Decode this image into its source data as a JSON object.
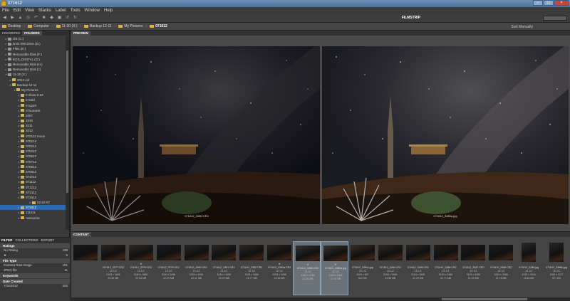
{
  "window": {
    "title": "071612"
  },
  "menu": [
    "File",
    "Edit",
    "View",
    "Stacks",
    "Label",
    "Tools",
    "Window",
    "Help"
  ],
  "toolbar": {
    "workspace": "FILMSTRIP",
    "sort": "Sort Manually"
  },
  "breadcrumb": [
    "Desktop",
    "Computer",
    "11-30 (X:)",
    "Backup 12-11",
    "My Pictures",
    "071612"
  ],
  "left_tabs": [
    "FAVORITES",
    "FOLDERS"
  ],
  "tree": [
    {
      "label": "OS (C:)",
      "icon": "drive"
    },
    {
      "label": "DVD RW Drive (D:)",
      "icon": "drive"
    },
    {
      "label": "Files (E:)",
      "icon": "drive"
    },
    {
      "label": "Removable Disk (F:)",
      "icon": "drive"
    },
    {
      "label": "EOS_DIGITAL (G:)",
      "icon": "drive"
    },
    {
      "label": "Removable Disk (H:)",
      "icon": "drive"
    },
    {
      "label": "Removable Disk (I:)",
      "icon": "drive"
    },
    {
      "label": "11-30 (X:)",
      "icon": "drive"
    },
    {
      "label": "2012 cal",
      "icon": "folder"
    },
    {
      "label": "Backup 12-11",
      "icon": "folder"
    },
    {
      "label": "My Pictures",
      "icon": "folder"
    },
    {
      "label": "0 show 6-10",
      "icon": "folder"
    },
    {
      "label": "0 Sold",
      "icon": "folder"
    },
    {
      "label": "0 top20",
      "icon": "folder"
    },
    {
      "label": "07sunsets",
      "icon": "folder"
    },
    {
      "label": "2007",
      "icon": "folder"
    },
    {
      "label": "2010",
      "icon": "folder"
    },
    {
      "label": "2011",
      "icon": "folder"
    },
    {
      "label": "2012",
      "icon": "folder"
    },
    {
      "label": "070112 moon",
      "icon": "folder"
    },
    {
      "label": "070212",
      "icon": "folder"
    },
    {
      "label": "070312",
      "icon": "folder"
    },
    {
      "label": "070412",
      "icon": "folder"
    },
    {
      "label": "070612",
      "icon": "folder"
    },
    {
      "label": "070712",
      "icon": "folder"
    },
    {
      "label": "070812",
      "icon": "folder"
    },
    {
      "label": "070912",
      "icon": "folder"
    },
    {
      "label": "071012",
      "icon": "folder"
    },
    {
      "label": "071112",
      "icon": "folder"
    },
    {
      "label": "071212",
      "icon": "folder"
    },
    {
      "label": "071412",
      "icon": "folder"
    },
    {
      "label": "071512",
      "icon": "folder"
    },
    {
      "label": "02-22-07",
      "icon": "folder"
    },
    {
      "label": "071612",
      "icon": "folder",
      "selected": true
    },
    {
      "label": "111311",
      "icon": "folder"
    },
    {
      "label": "Awesome",
      "icon": "folder"
    }
  ],
  "filter": {
    "tabs": [
      "FILTER",
      "COLLECTIONS",
      "EXPORT"
    ],
    "sections": [
      {
        "title": "Ratings",
        "rows": [
          {
            "label": "No Rating",
            "count": "196"
          },
          {
            "label": "★",
            "count": "5"
          }
        ]
      },
      {
        "title": "File Type",
        "rows": [
          {
            "label": "Camera Raw image",
            "count": "191"
          },
          {
            "label": "JPEG file",
            "count": "11"
          }
        ]
      },
      {
        "title": "Keywords",
        "rows": []
      },
      {
        "title": "Date Created",
        "rows": [
          {
            "label": "7/16/2012",
            "count": "200"
          }
        ]
      }
    ]
  },
  "preview": {
    "tab": "PREVIEW",
    "images": [
      {
        "caption": "071612_3380.CR2"
      },
      {
        "caption": "071612_3380a.jpg"
      }
    ]
  },
  "content": {
    "tab": "CONTENT",
    "thumbs": [
      {
        "name": "",
        "star": "",
        "meta1": "",
        "meta2": "",
        "meta3": "",
        "selected": false
      },
      {
        "name": "071612_3377.CR2",
        "star": "",
        "meta1": "15 1/2",
        "meta2": "5184 x 3456",
        "meta3": "22.39 MB",
        "selected": false
      },
      {
        "name": "071612_3378.CR2",
        "star": "★",
        "meta1": "15 1/2",
        "meta2": "5184 x 3456",
        "meta3": "22.54 MB",
        "selected": false
      },
      {
        "name": "071612_3379.CR2",
        "star": "",
        "meta1": "15 1/2",
        "meta2": "5184 x 3456",
        "meta3": "22.29 MB",
        "selected": false
      },
      {
        "name": "071612_3380.CR2",
        "star": "",
        "meta1": "15 1/2",
        "meta2": "5184 x 3456",
        "meta3": "22.41 MB",
        "selected": false
      },
      {
        "name": "071612_3381.CR2",
        "star": "",
        "meta1": "15 1/2",
        "meta2": "5184 x 3456",
        "meta3": "23.29 MB",
        "selected": false
      },
      {
        "name": "071612_3382.CR2",
        "star": "",
        "meta1": "15 1/2",
        "meta2": "5184 x 3456",
        "meta3": "22.77 MB",
        "selected": false
      },
      {
        "name": "071612_3383a.CR2",
        "star": "★",
        "meta1": "15 1/2",
        "meta2": "5184 x 3456",
        "meta3": "22.26 MB",
        "selected": false
      },
      {
        "name": "071612_3380.CR2",
        "star": "★",
        "meta1": "15 1/2",
        "meta2": "5184 x 3456",
        "meta3": "22.26 MB",
        "selected": true
      },
      {
        "name": "071612_3380a.jpg",
        "star": "★",
        "meta1": "15 1/2",
        "meta2": "5184 x 3456",
        "meta3": "17.42 MB",
        "selected": true
      },
      {
        "name": "071612_3381n.jpg",
        "star": "",
        "meta1": "15 1/2",
        "meta2": "1000 x 667",
        "meta3": "642 KB",
        "selected": false
      },
      {
        "name": "071612_3384.CR2",
        "star": "",
        "meta1": "15 1/2",
        "meta2": "5184 x 3456",
        "meta3": "22.56 MB",
        "selected": false
      },
      {
        "name": "071612_3385.CR2",
        "star": "",
        "meta1": "15 1/2",
        "meta2": "5184 x 3456",
        "meta3": "22.29 MB",
        "selected": false
      },
      {
        "name": "071612_3386.CR2",
        "star": "",
        "meta1": "15 1/2",
        "meta2": "5184 x 3456",
        "meta3": "21.71 MB",
        "selected": false
      },
      {
        "name": "071612_3387.CR2",
        "star": "",
        "meta1": "15 1/2",
        "meta2": "5184 x 3456",
        "meta3": "21.93 MB",
        "selected": false
      },
      {
        "name": "071612_3388.CR2",
        "star": "",
        "meta1": "15 1/2",
        "meta2": "5184 x 3456",
        "meta3": "21.78 MB",
        "selected": false
      },
      {
        "name": "071612_3388.jpg",
        "star": "",
        "meta1": "15 1/2",
        "meta2": "4375 x 3916",
        "meta3": "16.66 MB",
        "selected": false
      },
      {
        "name": "071612_3388n.jpg",
        "star": "",
        "meta1": "15 1/2",
        "meta2": "1000 x 1217",
        "meta3": "571 KB",
        "selected": false
      }
    ]
  },
  "colors": {
    "selection": "#2e6bb5",
    "folder": "#d9b446",
    "title_bar": "#5a7fa6"
  }
}
